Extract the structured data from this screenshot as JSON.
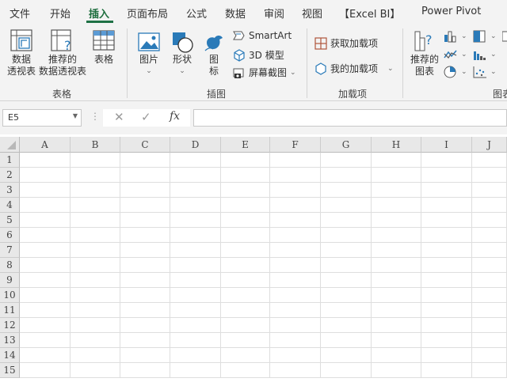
{
  "menu": {
    "tabs": [
      "文件",
      "开始",
      "插入",
      "页面布局",
      "公式",
      "数据",
      "审阅",
      "视图",
      "【Excel BI】",
      "Power Pivot"
    ],
    "active_tab": "插入",
    "accent_color": "#1e7145"
  },
  "ribbon": {
    "tables": {
      "pivot_l1": "数据",
      "pivot_l2": "透视表",
      "rec_pivot_l1": "推荐的",
      "rec_pivot_l2": "数据透视表",
      "table": "表格",
      "group": "表格"
    },
    "illustrations": {
      "picture": "图片",
      "shapes": "形状",
      "icons_l1": "图",
      "icons_l2": "标",
      "smartart": "SmartArt",
      "model3d": "3D 模型",
      "screenshot": "屏幕截图",
      "group": "插图"
    },
    "addins": {
      "get": "获取加载项",
      "my": "我的加载项",
      "group": "加载项"
    },
    "charts": {
      "recommended_l1": "推荐的",
      "recommended_l2": "图表",
      "group": "图表"
    }
  },
  "formula_bar": {
    "name_box": "E5",
    "cancel": "✕",
    "enter": "✓",
    "fx": "fx",
    "content": ""
  },
  "grid": {
    "columns": [
      "A",
      "B",
      "C",
      "D",
      "E",
      "F",
      "G",
      "H",
      "I",
      "J"
    ],
    "rows": [
      "1",
      "2",
      "3",
      "4",
      "5",
      "6",
      "7",
      "8",
      "9",
      "10",
      "11",
      "12",
      "13",
      "14",
      "15"
    ]
  }
}
